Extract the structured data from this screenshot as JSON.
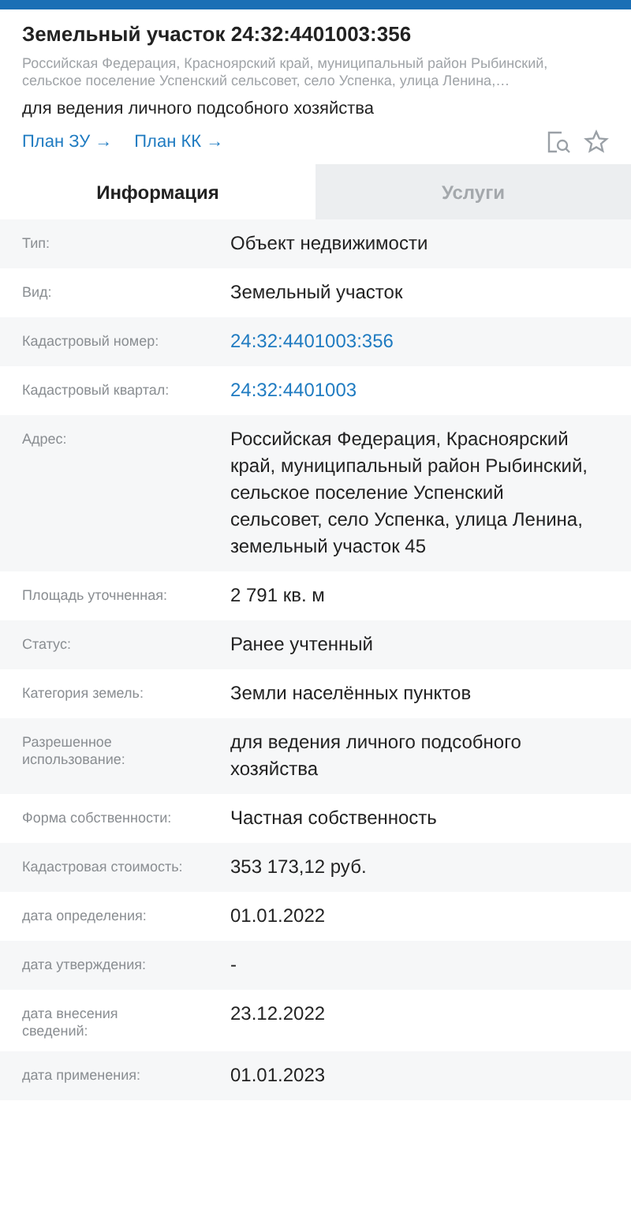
{
  "header": {
    "title": "Земельный участок 24:32:4401003:356",
    "address": "Российская Федерация, Красноярский край, муниципальный район Рыбинский, сельское поселение Успенский сельсовет, село Успенка, улица Ленина,…",
    "purpose": "для ведения личного подсобного хозяйства",
    "links": [
      "План ЗУ →",
      "План КК →"
    ]
  },
  "tabs": [
    {
      "label": "Информация",
      "selected": true
    },
    {
      "label": "Услуги",
      "selected": false
    }
  ],
  "rows": [
    {
      "label": "Тип:",
      "value": "Объект недвижимости",
      "kind": "text"
    },
    {
      "label": "Вид:",
      "value": "Земельный участок",
      "kind": "text"
    },
    {
      "label": "Кадастровый номер:",
      "value": "24:32:4401003:356",
      "kind": "link"
    },
    {
      "label": "Кадастровый квартал:",
      "value": "24:32:4401003",
      "kind": "link"
    },
    {
      "label": "Адрес:",
      "value": "Российская Федерация, Красноярский край, муниципальный район Рыбинский, сельское поселение Успенский сельсовет, село Успенка, улица Ленина, земельный участок 45",
      "kind": "text"
    },
    {
      "label": "Площадь уточненная:",
      "value": "2 791 кв. м",
      "kind": "text"
    },
    {
      "label": "Статус:",
      "value": "Ранее учтенный",
      "kind": "text"
    },
    {
      "label": "Категория земель:",
      "value": "Земли населённых пунктов",
      "kind": "text"
    },
    {
      "label": "Разрешенное использование:",
      "value": "для ведения личного подсобного хозяйства",
      "kind": "text"
    },
    {
      "label": "Форма собственности:",
      "value": "Частная собственность",
      "kind": "text"
    },
    {
      "label": "Кадастровая стоимость:",
      "value": "353 173,12 руб.",
      "kind": "text"
    },
    {
      "label": "дата определения:",
      "value": "01.01.2022",
      "kind": "text"
    },
    {
      "label": "дата утверждения:",
      "value": "-",
      "kind": "text"
    },
    {
      "label": "дата внесения сведений:",
      "value": "23.12.2022",
      "kind": "text"
    },
    {
      "label": "дата применения:",
      "value": "01.01.2023",
      "kind": "text"
    }
  ]
}
